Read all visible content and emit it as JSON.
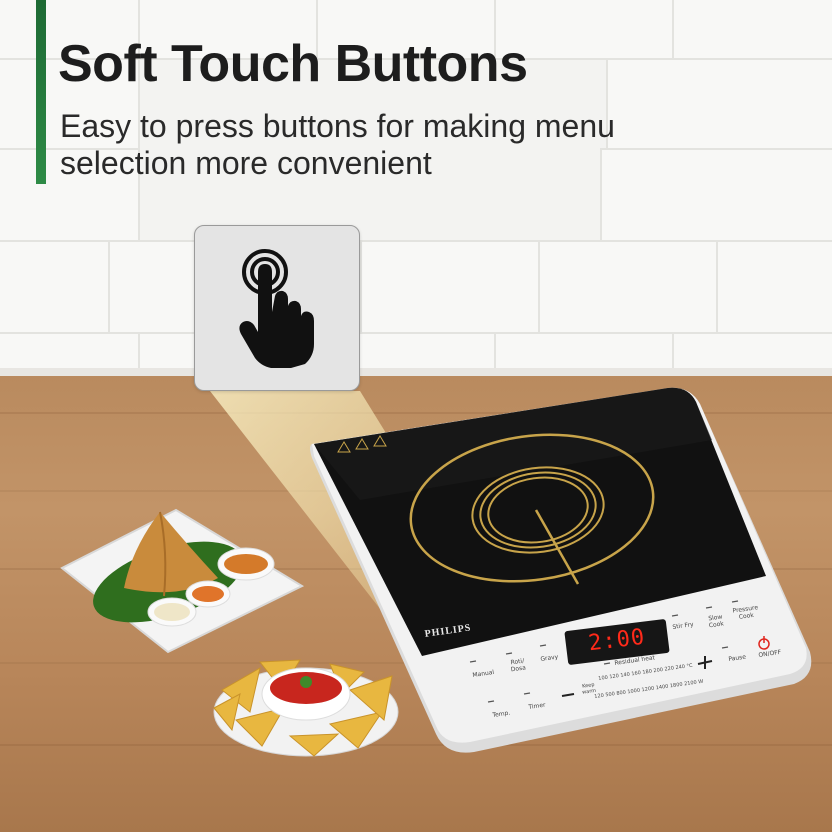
{
  "headline": {
    "title": "Soft Touch Buttons",
    "subtitle": "Easy to press buttons for making menu selection more convenient"
  },
  "colors": {
    "accent": "#2e8b46",
    "title": "#1d1d1d",
    "display_digits": "#ff2a1a",
    "coil": "#c8a44a"
  },
  "icons": {
    "touch": "finger-tap-icon",
    "power": "power-icon"
  },
  "cooktop": {
    "brand": "PHILIPS",
    "display": "2:00",
    "buttons": {
      "manual": "Manual",
      "roti": "Roti/ Dosa",
      "gravy": "Gravy",
      "stir_fry": "Stir Fry",
      "slow_cook": "Slow Cook",
      "pressure_cook": "Pressure Cook",
      "temp": "Temp.",
      "timer": "Timer",
      "minus": "−",
      "plus": "+",
      "pause": "Pause",
      "on_off": "ON/OFF"
    },
    "residual_heat": "Residual heat",
    "keep_warm": "Keep warm",
    "temp_scale": "100 120 140 160 180 200 220 240 °C",
    "power_scale": "120 500 800 1000 1200 1400 1800 2100 W"
  }
}
